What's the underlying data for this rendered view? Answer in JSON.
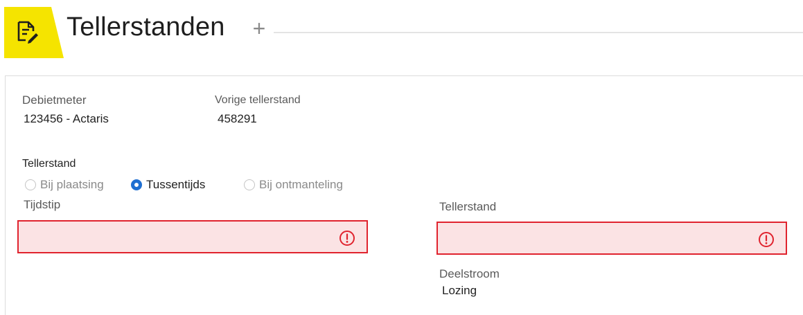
{
  "header": {
    "title": "Tellerstanden",
    "add_symbol": "+",
    "icon": "document-edit-icon",
    "accent_color": "#f5e400"
  },
  "form": {
    "debietmeter": {
      "label": "Debietmeter",
      "value": "123456 - Actaris"
    },
    "vorige_tellerstand": {
      "label": "Vorige tellerstand",
      "value": "458291"
    },
    "type_group": {
      "label": "Tellerstand",
      "options": [
        {
          "label": "Bij plaatsing",
          "selected": false
        },
        {
          "label": "Tussentijds",
          "selected": true
        },
        {
          "label": "Bij ontmanteling",
          "selected": false
        }
      ]
    },
    "tijdstip": {
      "label": "Tijdstip",
      "value": "",
      "placeholder": "",
      "state": "error"
    },
    "tellerstand": {
      "label": "Tellerstand",
      "value": "",
      "placeholder": "",
      "state": "error"
    },
    "deelstroom": {
      "label": "Deelstroom",
      "value": "Lozing"
    }
  },
  "colors": {
    "error_border": "#e0232e",
    "error_fill": "#fbe3e4",
    "radio_selected": "#1f6fd1"
  }
}
